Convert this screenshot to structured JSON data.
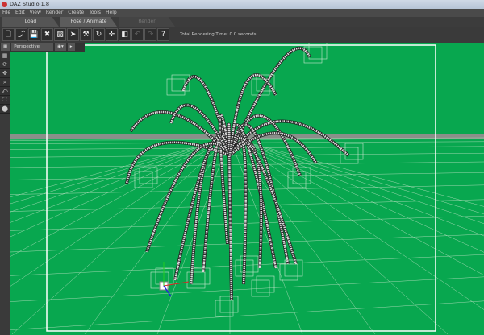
{
  "window": {
    "title": "DAZ Studio 1.8"
  },
  "menu": [
    "File",
    "Edit",
    "View",
    "Render",
    "Create",
    "Tools",
    "Help"
  ],
  "tabs": [
    {
      "label": "Load",
      "state": "normal"
    },
    {
      "label": "Pose / Animate",
      "state": "active"
    },
    {
      "label": "Render",
      "state": "disabled"
    }
  ],
  "toolbar": {
    "icons": [
      "new-icon",
      "open-icon",
      "save-icon",
      "delete-icon",
      "render-icon",
      "select-icon",
      "pose-icon",
      "rotate-icon",
      "move-icon",
      "scale-icon",
      "undo-icon",
      "redo-icon",
      "help-icon"
    ],
    "glyphs": [
      "🗋",
      "⤴",
      "💾",
      "✖",
      "▨",
      "➤",
      "⚒",
      "↻",
      "✛",
      "◧",
      "↶",
      "↷",
      "?"
    ],
    "render_time": "Total Rendering Time: 0.0 seconds"
  },
  "viewport": {
    "view_label": "Perspective View ▾",
    "shading_label": "◉▾",
    "next_label": "▸",
    "background": "#08a74f"
  },
  "left_tools": [
    "▦",
    "⟳",
    "✥",
    "⌕",
    "⤺",
    "⛶",
    "⬤"
  ]
}
